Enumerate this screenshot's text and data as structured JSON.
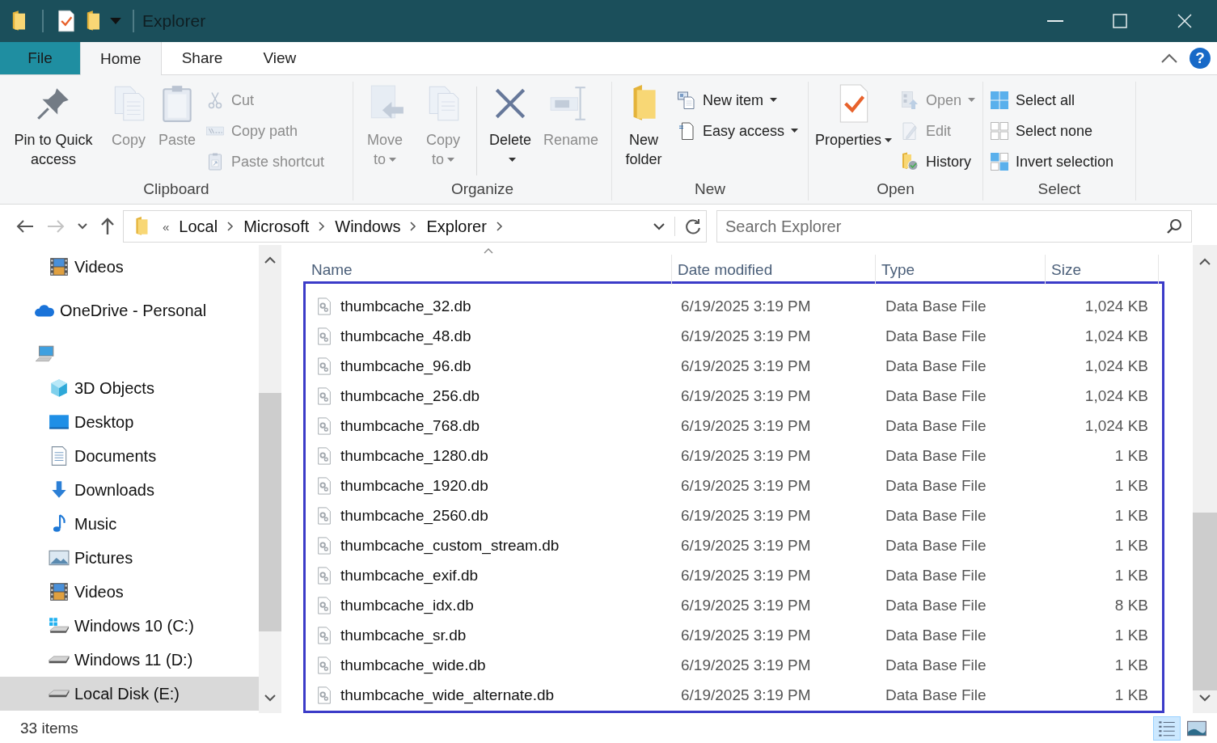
{
  "title_bar": {
    "title": "Explorer",
    "quick_access": [
      {
        "kind": "folder"
      },
      {
        "kind": "properties"
      },
      {
        "kind": "folder"
      },
      {
        "kind": "customize"
      }
    ]
  },
  "tabs": [
    {
      "label": "File",
      "kind": "file",
      "selected": false
    },
    {
      "label": "Home",
      "kind": "tab",
      "selected": true
    },
    {
      "label": "Share",
      "kind": "tab",
      "selected": false
    },
    {
      "label": "View",
      "kind": "tab",
      "selected": false
    }
  ],
  "help": "?",
  "ribbon": {
    "groups": [
      {
        "label": "Clipboard",
        "items": [
          {
            "kind": "large",
            "label": "Pin to Quick access",
            "disabled": false,
            "dropdown": false
          },
          {
            "kind": "large",
            "label": "Copy",
            "disabled": true,
            "dropdown": false
          },
          {
            "kind": "large",
            "label": "Paste",
            "disabled": true,
            "dropdown": false
          },
          {
            "kind": "stack",
            "items": [
              {
                "label": "Cut",
                "disabled": true,
                "dropdown": false
              },
              {
                "label": "Copy path",
                "disabled": true,
                "dropdown": false
              },
              {
                "label": "Paste shortcut",
                "disabled": true,
                "dropdown": false
              }
            ]
          }
        ]
      },
      {
        "label": "Organize",
        "items": [
          {
            "kind": "large",
            "label": "Move to",
            "disabled": true,
            "dropdown": true
          },
          {
            "kind": "large",
            "label": "Copy to",
            "disabled": true,
            "dropdown": true
          },
          {
            "kind": "large",
            "label": "Delete",
            "disabled": false,
            "dropdown": true
          },
          {
            "kind": "large",
            "label": "Rename",
            "disabled": true,
            "dropdown": false
          }
        ]
      },
      {
        "label": "New",
        "items": [
          {
            "kind": "large",
            "label": "New folder",
            "disabled": false,
            "dropdown": false
          },
          {
            "kind": "stack",
            "items": [
              {
                "label": "New item",
                "disabled": false,
                "dropdown": true
              },
              {
                "label": "Easy access",
                "disabled": false,
                "dropdown": true
              }
            ]
          }
        ]
      },
      {
        "label": "Open",
        "items": [
          {
            "kind": "large",
            "label": "Properties",
            "disabled": false,
            "dropdown": true
          },
          {
            "kind": "stack",
            "items": [
              {
                "label": "Open",
                "disabled": true,
                "dropdown": true
              },
              {
                "label": "Edit",
                "disabled": true,
                "dropdown": false
              },
              {
                "label": "History",
                "disabled": false,
                "dropdown": false
              }
            ]
          }
        ]
      },
      {
        "label": "Select",
        "items": [
          {
            "kind": "stack",
            "items": [
              {
                "label": "Select all",
                "disabled": false,
                "dropdown": false
              },
              {
                "label": "Select none",
                "disabled": false,
                "dropdown": false
              },
              {
                "label": "Invert selection",
                "disabled": false,
                "dropdown": false
              }
            ]
          }
        ]
      }
    ]
  },
  "address": {
    "back_disabled": false,
    "forward_disabled": true,
    "overflow": "«",
    "crumbs": [
      "Local",
      "Microsoft",
      "Windows",
      "Explorer"
    ],
    "search_placeholder": "Search Explorer"
  },
  "nav": {
    "items": [
      {
        "children": [
          {
            "kind": "video",
            "label": "Videos",
            "selected": false
          }
        ]
      },
      {
        "kind": "cloud",
        "label": "OneDrive - Personal",
        "selected": false
      },
      {
        "kind": "pc",
        "selected": false,
        "children": [
          {
            "kind": "cube",
            "label": "3D Objects",
            "selected": false
          },
          {
            "kind": "desktop",
            "label": "Desktop",
            "selected": false
          },
          {
            "kind": "documents",
            "label": "Documents",
            "selected": false
          },
          {
            "kind": "downloads",
            "label": "Downloads",
            "selected": false
          },
          {
            "kind": "music",
            "label": "Music",
            "selected": false
          },
          {
            "kind": "pictures",
            "label": "Pictures",
            "selected": false
          },
          {
            "kind": "video",
            "label": "Videos",
            "selected": false
          },
          {
            "kind": "windrive",
            "label": "Windows 10 (C:)",
            "selected": false
          },
          {
            "kind": "drive",
            "label": "Windows 11 (D:)",
            "selected": false
          },
          {
            "kind": "drive",
            "label": "Local Disk (E:)",
            "selected": true
          }
        ]
      }
    ]
  },
  "file_list": {
    "highlighted": true,
    "columns": [
      {
        "label": "Name",
        "sorted": true
      },
      {
        "label": "Date modified",
        "sorted": false
      },
      {
        "label": "Type",
        "sorted": false
      },
      {
        "label": "Size",
        "sorted": false
      }
    ],
    "rows": [
      {
        "name": "thumbcache_32.db",
        "date": "6/19/2025 3:19 PM",
        "type": "Data Base File",
        "size": "1,024 KB"
      },
      {
        "name": "thumbcache_48.db",
        "date": "6/19/2025 3:19 PM",
        "type": "Data Base File",
        "size": "1,024 KB"
      },
      {
        "name": "thumbcache_96.db",
        "date": "6/19/2025 3:19 PM",
        "type": "Data Base File",
        "size": "1,024 KB"
      },
      {
        "name": "thumbcache_256.db",
        "date": "6/19/2025 3:19 PM",
        "type": "Data Base File",
        "size": "1,024 KB"
      },
      {
        "name": "thumbcache_768.db",
        "date": "6/19/2025 3:19 PM",
        "type": "Data Base File",
        "size": "1,024 KB"
      },
      {
        "name": "thumbcache_1280.db",
        "date": "6/19/2025 3:19 PM",
        "type": "Data Base File",
        "size": "1 KB"
      },
      {
        "name": "thumbcache_1920.db",
        "date": "6/19/2025 3:19 PM",
        "type": "Data Base File",
        "size": "1 KB"
      },
      {
        "name": "thumbcache_2560.db",
        "date": "6/19/2025 3:19 PM",
        "type": "Data Base File",
        "size": "1 KB"
      },
      {
        "name": "thumbcache_custom_stream.db",
        "date": "6/19/2025 3:19 PM",
        "type": "Data Base File",
        "size": "1 KB"
      },
      {
        "name": "thumbcache_exif.db",
        "date": "6/19/2025 3:19 PM",
        "type": "Data Base File",
        "size": "1 KB"
      },
      {
        "name": "thumbcache_idx.db",
        "date": "6/19/2025 3:19 PM",
        "type": "Data Base File",
        "size": "8 KB"
      },
      {
        "name": "thumbcache_sr.db",
        "date": "6/19/2025 3:19 PM",
        "type": "Data Base File",
        "size": "1 KB"
      },
      {
        "name": "thumbcache_wide.db",
        "date": "6/19/2025 3:19 PM",
        "type": "Data Base File",
        "size": "1 KB"
      },
      {
        "name": "thumbcache_wide_alternate.db",
        "date": "6/19/2025 3:19 PM",
        "type": "Data Base File",
        "size": "1 KB"
      }
    ]
  },
  "status_bar": {
    "count": "33 items",
    "views": [
      {
        "kind": "details",
        "selected": true
      },
      {
        "kind": "large_icons",
        "selected": false
      }
    ]
  }
}
